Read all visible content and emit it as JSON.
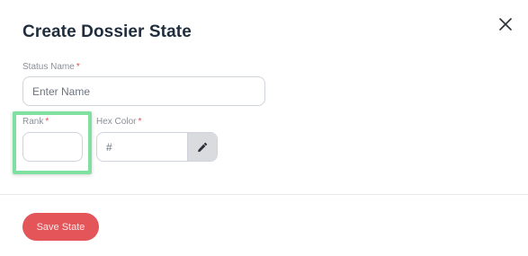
{
  "dialog": {
    "title": "Create Dossier State"
  },
  "form": {
    "status_name": {
      "label": "Status Name",
      "required_mark": "*",
      "placeholder": "Enter Name",
      "value": ""
    },
    "rank": {
      "label": "Rank",
      "required_mark": "*",
      "placeholder": "",
      "value": ""
    },
    "hex_color": {
      "label": "Hex Color",
      "required_mark": "*",
      "placeholder": "#",
      "value": ""
    }
  },
  "actions": {
    "save_label": "Save State"
  },
  "icons": {
    "close": "close-icon",
    "picker": "eyedropper-icon"
  },
  "colors": {
    "accent": "#e4555a",
    "required": "#e04b4b",
    "highlight": "#7fe0a0"
  }
}
